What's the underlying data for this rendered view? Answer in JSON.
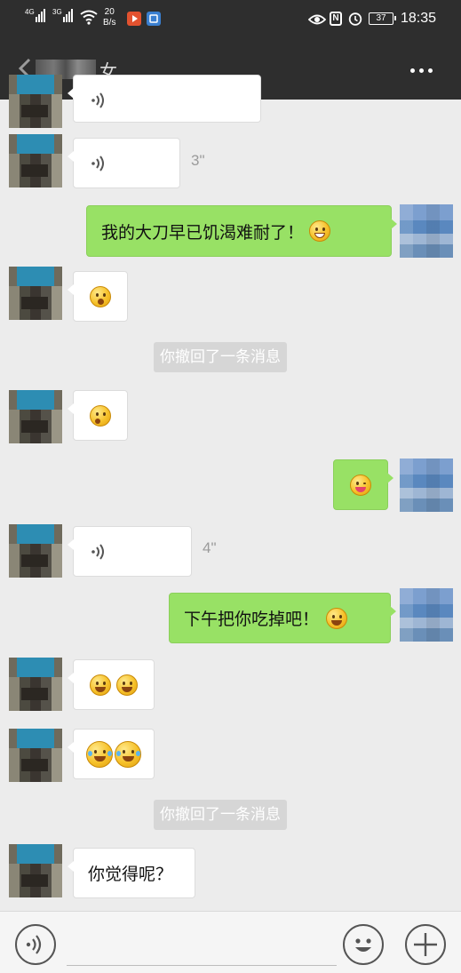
{
  "status_bar": {
    "signal1_label": "4G",
    "signal2_label": "3G",
    "net_speed_value": "20",
    "net_speed_unit": "B/s",
    "battery": "37",
    "time": "18:35"
  },
  "header": {
    "title_suffix": "女",
    "icons": {
      "back": "back-arrow-icon",
      "more": "more-dots-icon"
    }
  },
  "messages": [
    {
      "type": "voice",
      "side": "left"
    },
    {
      "type": "voice",
      "side": "left",
      "duration": "3\""
    },
    {
      "type": "text",
      "side": "right",
      "text": "我的大刀早已饥渴难耐了！",
      "emoji": "grinning-teeth-emoji"
    },
    {
      "type": "emoji",
      "side": "left",
      "emoji": "surprised-face-emoji"
    },
    {
      "type": "system",
      "text": "你撤回了一条消息"
    },
    {
      "type": "emoji",
      "side": "left",
      "emoji": "dizzy-face-emoji"
    },
    {
      "type": "emoji",
      "side": "right",
      "emoji": "tongue-wink-emoji"
    },
    {
      "type": "voice",
      "side": "left",
      "duration": "4\""
    },
    {
      "type": "text",
      "side": "right",
      "text": "下午把你吃掉吧！",
      "emoji": "grinning-emoji"
    },
    {
      "type": "emoji",
      "side": "left",
      "emoji": "grinning-emoji x2"
    },
    {
      "type": "emoji",
      "side": "left",
      "emoji": "tears-of-joy-emoji x2"
    },
    {
      "type": "system",
      "text": "你撤回了一条消息"
    },
    {
      "type": "text",
      "side": "left",
      "text": "你觉得呢？"
    }
  ],
  "input_bar": {
    "message_value": "",
    "icons": {
      "voice": "voice-toggle-icon",
      "emoji": "emoji-smiley-icon",
      "plus": "plus-icon"
    }
  },
  "colors": {
    "bar_background": "#2e2e2e",
    "chat_background": "#ececec",
    "self_bubble": "#98e165",
    "friend_bubble": "#ffffff",
    "system_tip": "#d6d6d6"
  }
}
